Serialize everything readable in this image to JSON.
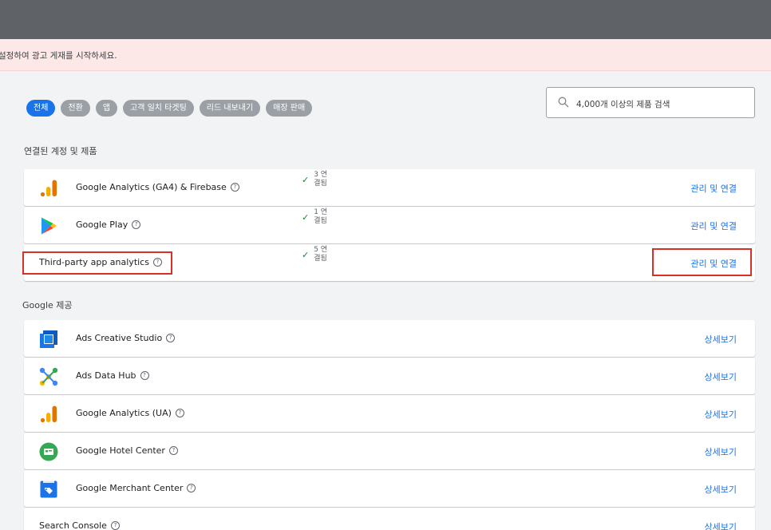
{
  "notice": {
    "text": "설정하여 광고 게재를 시작하세요."
  },
  "filters": [
    {
      "label": "전체",
      "active": true
    },
    {
      "label": "전환",
      "active": false
    },
    {
      "label": "앱",
      "active": false
    },
    {
      "label": "고객 일치 타겟팅",
      "active": false
    },
    {
      "label": "리드 내보내기",
      "active": false
    },
    {
      "label": "매장 판매",
      "active": false
    }
  ],
  "search": {
    "placeholder": "4,000개 이상의 제품 검색",
    "icon": "search-icon"
  },
  "linked": {
    "title": "연결된 계정 및 제품",
    "items": [
      {
        "name": "Google Analytics (GA4) & Firebase",
        "status": "3 연결됨",
        "action": "관리 및 연결",
        "icon": "google-analytics-icon"
      },
      {
        "name": "Google Play",
        "status": "1 연결됨",
        "action": "관리 및 연결",
        "icon": "google-play-icon"
      },
      {
        "name": "Third-party app analytics",
        "status": "5 연결됨",
        "action": "관리 및 연결"
      }
    ]
  },
  "google": {
    "title": "Google 제공",
    "items": [
      {
        "name": "Ads Creative Studio",
        "action": "상세보기",
        "icon": "ads-creative-studio-icon"
      },
      {
        "name": "Ads Data Hub",
        "action": "상세보기",
        "icon": "ads-data-hub-icon"
      },
      {
        "name": "Google Analytics (UA)",
        "action": "상세보기",
        "icon": "google-analytics-icon"
      },
      {
        "name": "Google Hotel Center",
        "action": "상세보기",
        "icon": "hotel-center-icon"
      },
      {
        "name": "Google Merchant Center",
        "action": "상세보기",
        "icon": "merchant-center-icon"
      },
      {
        "name": "Search Console",
        "action": "상세보기"
      }
    ]
  },
  "colors": {
    "accent": "#1a73e8",
    "highlight": "#d93025",
    "topbar": "#5f6368",
    "notice_bg": "#fce8e6"
  }
}
